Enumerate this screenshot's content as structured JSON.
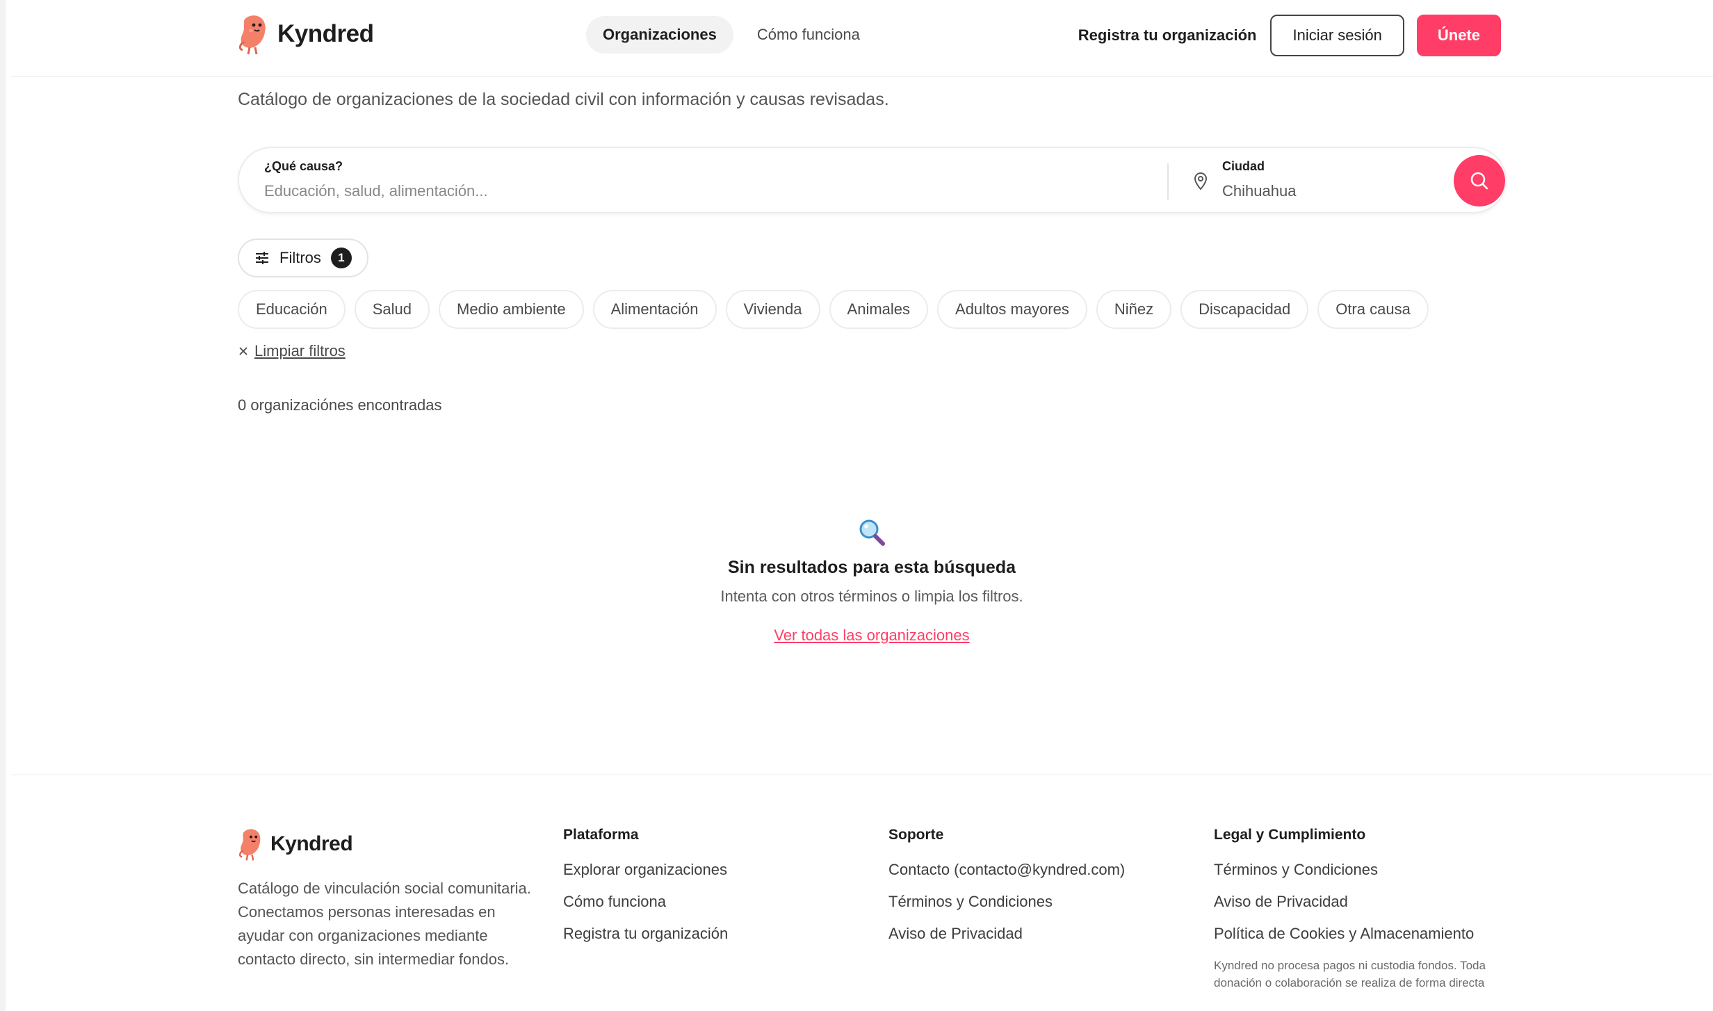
{
  "brand": {
    "name": "Kyndred",
    "accent": "#ff3d66"
  },
  "header": {
    "tabs": [
      "Organizaciones",
      "Cómo funciona"
    ],
    "register_link": "Registra tu organización",
    "login_label": "Iniciar sesión",
    "join_label": "Únete"
  },
  "subtitle": "Catálogo de organizaciones de la sociedad civil con información y causas revisadas.",
  "search": {
    "cause_label": "¿Qué causa?",
    "cause_placeholder": "Educación, salud, alimentación...",
    "city_label": "Ciudad",
    "city_value": "Chihuahua",
    "pin_icon": "map-pin-icon",
    "search_icon": "search-icon"
  },
  "filters": {
    "label": "Filtros",
    "count": "1",
    "chips": [
      "Educación",
      "Salud",
      "Medio ambiente",
      "Alimentación",
      "Vivienda",
      "Animales",
      "Adultos mayores",
      "Niñez",
      "Discapacidad",
      "Otra causa"
    ],
    "clear_label": "Limpiar filtros"
  },
  "results": {
    "count_text": "0 organizaciónes encontradas"
  },
  "empty_state": {
    "icon": "magnifier-emoji-icon",
    "title": "Sin resultados para esta búsqueda",
    "subtitle": "Intenta con otros términos o limpia los filtros.",
    "link": "Ver todas las organizaciones"
  },
  "footer": {
    "description": "Catálogo de vinculación social comunitaria. Conectamos personas interesadas en ayudar con organizaciones mediante contacto directo, sin intermediar fondos.",
    "columns": [
      {
        "title": "Plataforma",
        "items": [
          "Explorar organizaciones",
          "Cómo funciona",
          "Registra tu organización"
        ]
      },
      {
        "title": "Soporte",
        "items": [
          "Contacto (contacto@kyndred.com)",
          "Términos y Condiciones",
          "Aviso de Privacidad"
        ]
      },
      {
        "title": "Legal y Cumplimiento",
        "items": [
          "Términos y Condiciones",
          "Aviso de Privacidad",
          "Política de Cookies y Almacenamiento"
        ]
      }
    ],
    "note": "Kyndred no procesa pagos ni custodia fondos. Toda donación o colaboración se realiza de forma directa"
  }
}
